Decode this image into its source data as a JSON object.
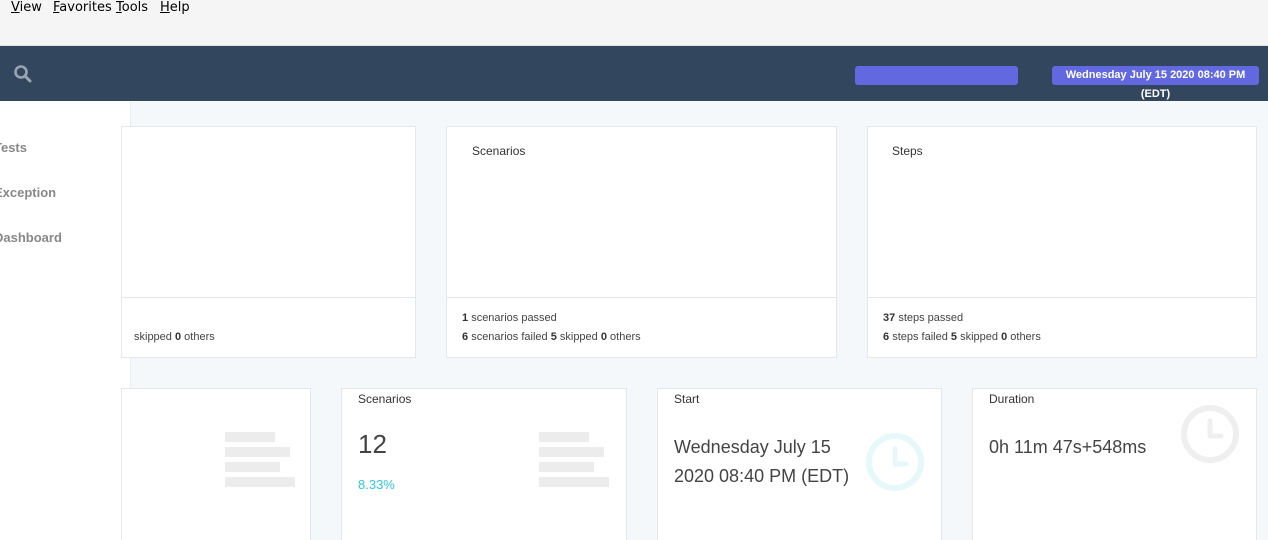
{
  "menu": {
    "view": "View",
    "favorites": "Favorites",
    "tools": "Tools",
    "help": "Help"
  },
  "topnav": {
    "search_icon": "search-icon",
    "date_badge": "Wednesday July 15 2020 08:40 PM (EDT)"
  },
  "sidebar": {
    "items": [
      {
        "label": "Tests"
      },
      {
        "label": "Exception"
      },
      {
        "label": "Dashboard"
      }
    ]
  },
  "cards": {
    "tests": {
      "skipped_count": "0",
      "skipped_text": "skipped",
      "others_count": "0",
      "others_text": "others"
    },
    "scenarios": {
      "title": "Scenarios",
      "passed_count": "1",
      "passed_text": "scenarios passed",
      "failed_count": "6",
      "failed_text": "scenarios failed",
      "skipped_count": "5",
      "skipped_text": "skipped",
      "others_count": "0",
      "others_text": "others"
    },
    "steps": {
      "title": "Steps",
      "passed_count": "37",
      "passed_text": "steps passed",
      "failed_count": "6",
      "failed_text": "steps failed",
      "skipped_count": "5",
      "skipped_text": "skipped",
      "others_count": "0",
      "others_text": "others"
    }
  },
  "stats": {
    "scenarios": {
      "title": "Scenarios",
      "value": "12",
      "percent": "8.33%"
    },
    "start": {
      "title": "Start",
      "value": "Wednesday July 15 2020 08:40 PM (EDT)"
    },
    "duration": {
      "title": "Duration",
      "value": "0h 11m 47s+548ms"
    }
  },
  "colors": {
    "nav_bg": "#32475e",
    "accent": "#6168e0",
    "teal": "#2ecad6"
  }
}
